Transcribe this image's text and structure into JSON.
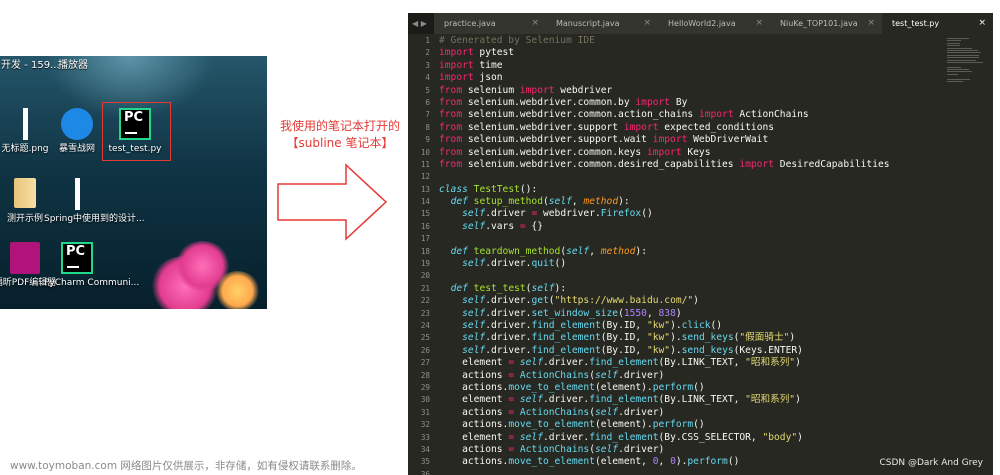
{
  "desktop": {
    "top_labels": [
      "开发 - 159...",
      "播放器"
    ],
    "icons": [
      {
        "label": "无标题.png",
        "icon": "white-bar"
      },
      {
        "label": "暴雪战网",
        "icon": "battlenet-icon"
      },
      {
        "label": "test_test.py",
        "icon": "pycharm-file-icon"
      },
      {
        "label": "测开示例",
        "icon": "folder-icon"
      },
      {
        "label": "Spring中使用到的设计...",
        "icon": "white-bar"
      },
      {
        "label": "福昕PDF编辑器",
        "icon": "pdf-editor-icon"
      },
      {
        "label": "PyCharm Communi...",
        "icon": "pycharm-icon"
      }
    ],
    "pc_text": "PC"
  },
  "annotation": {
    "line1": "我使用的笔记本打开的",
    "line2": "【subline 笔记本】",
    "color": "#e53935"
  },
  "editor": {
    "nav_arrows": "◀ ▶",
    "tabs": [
      {
        "label": "practice.java",
        "active": false
      },
      {
        "label": "Manuscript.java",
        "active": false
      },
      {
        "label": "HelloWorld2.java",
        "active": false
      },
      {
        "label": "NiuKe_TOP101.java",
        "active": false
      },
      {
        "label": "test_test.py",
        "active": true
      }
    ],
    "close_glyph": "×",
    "line_numbers": [
      "1",
      "2",
      "3",
      "4",
      "5",
      "6",
      "7",
      "8",
      "9",
      "10",
      "11",
      "12",
      "13",
      "14",
      "15",
      "16",
      "17",
      "18",
      "19",
      "20",
      "21",
      "22",
      "23",
      "24",
      "25",
      "26",
      "27",
      "28",
      "29",
      "30",
      "31",
      "32",
      "33",
      "34",
      "35",
      "36"
    ],
    "code_lines": [
      "# Generated by Selenium IDE",
      "import pytest",
      "import time",
      "import json",
      "from selenium import webdriver",
      "from selenium.webdriver.common.by import By",
      "from selenium.webdriver.common.action_chains import ActionChains",
      "from selenium.webdriver.support import expected_conditions",
      "from selenium.webdriver.support.wait import WebDriverWait",
      "from selenium.webdriver.common.keys import Keys",
      "from selenium.webdriver.common.desired_capabilities import DesiredCapabilities",
      "",
      "class TestTest():",
      "  def setup_method(self, method):",
      "    self.driver = webdriver.Firefox()",
      "    self.vars = {}",
      "",
      "  def teardown_method(self, method):",
      "    self.driver.quit()",
      "",
      "  def test_test(self):",
      "    self.driver.get(\"https://www.baidu.com/\")",
      "    self.driver.set_window_size(1550, 838)",
      "    self.driver.find_element(By.ID, \"kw\").click()",
      "    self.driver.find_element(By.ID, \"kw\").send_keys(\"假面骑士\")",
      "    self.driver.find_element(By.ID, \"kw\").send_keys(Keys.ENTER)",
      "    element = self.driver.find_element(By.LINK_TEXT, \"昭和系列\")",
      "    actions = ActionChains(self.driver)",
      "    actions.move_to_element(element).perform()",
      "    element = self.driver.find_element(By.LINK_TEXT, \"昭和系列\")",
      "    actions = ActionChains(self.driver)",
      "    actions.move_to_element(element).perform()",
      "    element = self.driver.find_element(By.CSS_SELECTOR, \"body\")",
      "    actions = ActionChains(self.driver)",
      "    actions.move_to_element(element, 0, 0).perform()",
      ""
    ]
  },
  "watermark": "www.toymoban.com 网络图片仅供展示，非存储，如有侵权请联系删除。",
  "credit": "CSDN @Dark And Grey"
}
